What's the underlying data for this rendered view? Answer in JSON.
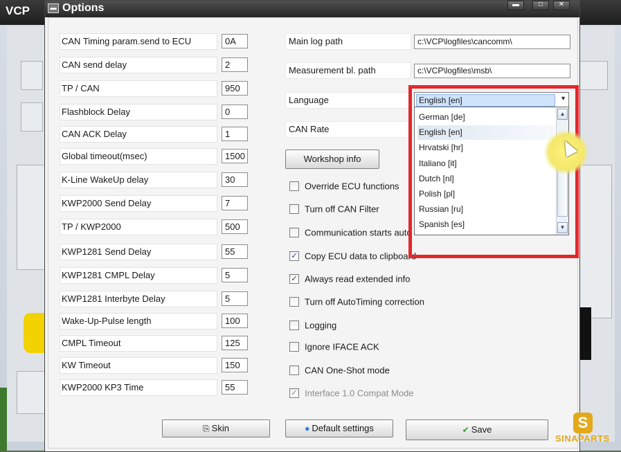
{
  "background_app": {
    "title": "VCP"
  },
  "dialog": {
    "title": "Options",
    "controls": {
      "minimize": "▬",
      "maximize": "□",
      "close": "✕"
    }
  },
  "params": [
    {
      "label": "CAN Timing param.send to ECU",
      "value": "0A"
    },
    {
      "label": "CAN send delay",
      "value": "2"
    },
    {
      "label": "TP / CAN",
      "value": "950"
    },
    {
      "label": "Flashblock Delay",
      "value": "0"
    },
    {
      "label": "CAN ACK Delay",
      "value": "1"
    },
    {
      "label": "Global timeout(msec)",
      "value": "1500"
    },
    {
      "label": "K-Line WakeUp delay",
      "value": "30"
    },
    {
      "label": "KWP2000 Send Delay",
      "value": "7"
    },
    {
      "label": "TP / KWP2000",
      "value": "500"
    },
    {
      "label": "KWP1281 Send Delay",
      "value": "55"
    },
    {
      "label": "KWP1281 CMPL Delay",
      "value": "5"
    },
    {
      "label": "KWP1281 Interbyte Delay",
      "value": "5"
    },
    {
      "label": "Wake-Up-Pulse length",
      "value": "100"
    },
    {
      "label": "CMPL Timeout",
      "value": "125"
    },
    {
      "label": "KW Timeout",
      "value": "150"
    },
    {
      "label": "KWP2000 KP3 Time",
      "value": "55"
    }
  ],
  "paths": {
    "main_log_label": "Main log path",
    "main_log_value": "c:\\VCP\\logfiles\\cancomm\\",
    "measurement_label": "Measurement bl. path",
    "measurement_value": "c:\\VCP\\logfiles\\msb\\"
  },
  "language": {
    "label": "Language",
    "selected": "English [en]",
    "options": [
      "German [de]",
      "English [en]",
      "Hrvatski [hr]",
      "Italiano [it]",
      "Dutch [nl]",
      "Polish [pl]",
      "Russian [ru]",
      "Spanish [es]"
    ],
    "highlighted_index": 1
  },
  "can_rate_label": "CAN Rate",
  "workshop_button": "Workshop info",
  "checkboxes": [
    {
      "label": "Override ECU functions",
      "checked": false,
      "disabled": false
    },
    {
      "label": "Turn off CAN Filter",
      "checked": false,
      "disabled": false
    },
    {
      "label": "Communication starts auto",
      "checked": false,
      "disabled": false
    },
    {
      "label": "Copy ECU data to clipboard",
      "checked": true,
      "disabled": false
    },
    {
      "label": "Always read extended info",
      "checked": true,
      "disabled": false
    },
    {
      "label": "Turn off AutoTiming correction",
      "checked": false,
      "disabled": false
    },
    {
      "label": "Logging",
      "checked": false,
      "disabled": false
    },
    {
      "label": "Ignore IFACE ACK",
      "checked": false,
      "disabled": false
    },
    {
      "label": "CAN One-Shot mode",
      "checked": false,
      "disabled": false
    },
    {
      "label": "Interface 1.0 Compat Mode",
      "checked": true,
      "disabled": true
    }
  ],
  "buttons": {
    "skin": "Skin",
    "default_settings": "Default settings",
    "save": "Save"
  },
  "icons": {
    "skin": "skin-icon",
    "default_settings": "refresh-globe-icon",
    "save": "green-check-icon",
    "dropdown_arrow": "chevron-down-icon"
  },
  "colors": {
    "highlight_border": "#e3282d",
    "selection": "#cfe3fb",
    "watermark": "#e3a91b"
  },
  "watermark": {
    "logo_letter": "S",
    "text": "SINAPARTS"
  }
}
